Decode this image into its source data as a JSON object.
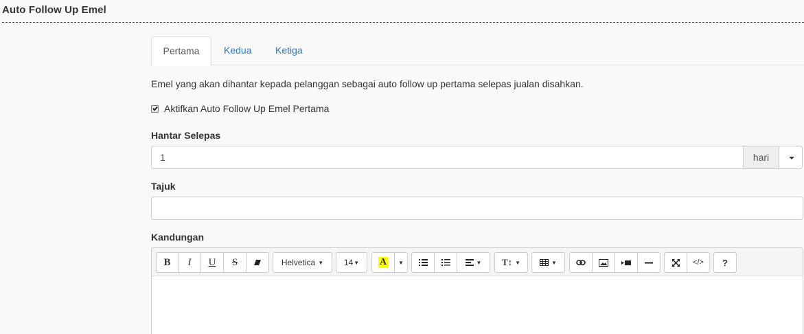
{
  "section": {
    "title": "Auto Follow Up Emel"
  },
  "tabs": [
    {
      "label": "Pertama",
      "active": true
    },
    {
      "label": "Kedua",
      "active": false
    },
    {
      "label": "Ketiga",
      "active": false
    }
  ],
  "description": "Emel yang akan dihantar kepada pelanggan sebagai auto follow up pertama selepas jualan disahkan.",
  "enable_checkbox": {
    "label": "Aktifkan Auto Follow Up Emel Pertama",
    "checked": true
  },
  "send_after": {
    "label": "Hantar Selepas",
    "value": "1",
    "unit": "hari"
  },
  "subject": {
    "label": "Tajuk",
    "value": ""
  },
  "content": {
    "label": "Kandungan"
  },
  "toolbar": {
    "bold": "B",
    "italic": "I",
    "underline": "U",
    "strike": "S",
    "eraser_icon": "eraser-icon",
    "font_family": "Helvetica",
    "font_size": "14",
    "color": "A",
    "ul_icon": "unordered-list-icon",
    "ol_icon": "ordered-list-icon",
    "align_icon": "align-icon",
    "height": "T↕",
    "table_icon": "table-icon",
    "link_icon": "link-icon",
    "picture_icon": "picture-icon",
    "video_icon": "video-icon",
    "hr_icon": "horizontal-rule-icon",
    "fullscreen_icon": "fullscreen-icon",
    "code": "</>",
    "help": "?"
  },
  "colors": {
    "accent": "#337ab7",
    "highlight": "#ffff00"
  }
}
